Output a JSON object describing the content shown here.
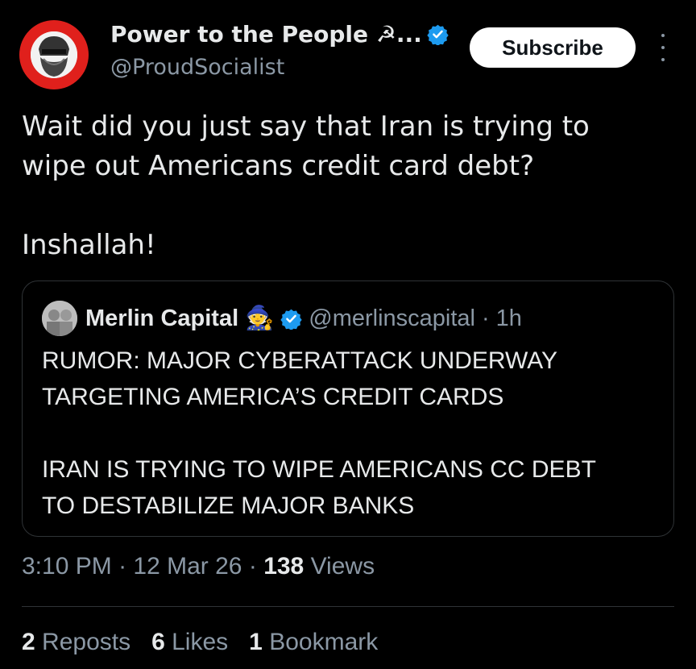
{
  "post": {
    "author_name": "Power to the People ☭...",
    "handle": "@ProudSocialist",
    "subscribe_label": "Subscribe",
    "text_line1": "Wait did you just say that Iran is trying to",
    "text_line2": "wipe out Americans credit card debt?",
    "text_line3": "Inshallah!",
    "time": "3:10 PM",
    "date": "12 Mar 26",
    "views_count": "138",
    "views_label": "Views",
    "sep": "·"
  },
  "quote": {
    "author_name": "Merlin Capital",
    "emoji": "🧙",
    "handle": "@merlinscapital",
    "age": "1h",
    "sep": "·",
    "line1": "RUMOR: MAJOR CYBERATTACK UNDERWAY",
    "line2": "TARGETING AMERICA’S CREDIT CARDS",
    "line3": "IRAN IS TRYING TO WIPE AMERICANS CC DEBT",
    "line4": "TO DESTABILIZE MAJOR BANKS"
  },
  "stats": {
    "reposts_count": "2",
    "reposts_label": "Reposts",
    "likes_count": "6",
    "likes_label": "Likes",
    "bookmarks_count": "1",
    "bookmarks_label": "Bookmark"
  },
  "colors": {
    "background": "#000000",
    "verified": "#1d9bf0",
    "avatar_ring": "#e0201c",
    "secondary_text": "#8b98a5"
  },
  "icons": {
    "verified": "verified-badge-icon",
    "more": "more-options-icon"
  }
}
